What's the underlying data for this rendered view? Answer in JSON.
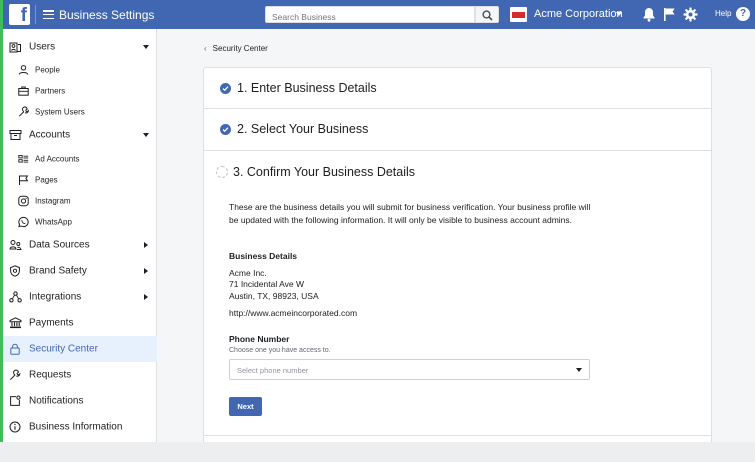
{
  "topbar": {
    "logo": "f",
    "menu_icon": "hamburger-menu-icon",
    "title": "Business Settings",
    "search_placeholder": "Search Business",
    "business_name": "Acme Corporation",
    "help_label": "Help",
    "help_glyph": "?",
    "icons": [
      "search-icon",
      "notification-bell-icon",
      "flag-icon",
      "gear-icon",
      "help-icon"
    ],
    "color": "#4267b2"
  },
  "sidebar": {
    "items": [
      {
        "label": "Users",
        "icon": "users-icon",
        "level": "top",
        "expandable": "down"
      },
      {
        "label": "People",
        "icon": "person-icon",
        "level": "sub"
      },
      {
        "label": "Partners",
        "icon": "briefcase-icon",
        "level": "sub"
      },
      {
        "label": "System Users",
        "icon": "wrench-icon",
        "level": "sub"
      },
      {
        "label": "Accounts",
        "icon": "accounts-icon",
        "level": "top",
        "expandable": "down"
      },
      {
        "label": "Ad Accounts",
        "icon": "ad-accounts-icon",
        "level": "sub"
      },
      {
        "label": "Pages",
        "icon": "flag-icon",
        "level": "sub"
      },
      {
        "label": "Instagram",
        "icon": "instagram-icon",
        "level": "sub"
      },
      {
        "label": "WhatsApp",
        "icon": "whatsapp-icon",
        "level": "sub"
      },
      {
        "label": "Data Sources",
        "icon": "data-sources-icon",
        "level": "top",
        "expandable": "right"
      },
      {
        "label": "Brand Safety",
        "icon": "shield-icon",
        "level": "top",
        "expandable": "right"
      },
      {
        "label": "Integrations",
        "icon": "integrations-icon",
        "level": "top",
        "expandable": "right"
      },
      {
        "label": "Payments",
        "icon": "bank-icon",
        "level": "top"
      },
      {
        "label": "Security Center",
        "icon": "lock-icon",
        "level": "top",
        "active": true
      },
      {
        "label": "Requests",
        "icon": "requests-icon",
        "level": "top"
      },
      {
        "label": "Notifications",
        "icon": "notifications-icon",
        "level": "top"
      },
      {
        "label": "Business Information",
        "icon": "info-icon",
        "level": "top"
      }
    ],
    "active_color": "#e7f0fd",
    "accent_color": "#3dbf58"
  },
  "main": {
    "breadcrumb": "Security Center",
    "steps": [
      {
        "title": "1. Enter Business Details",
        "status": "complete"
      },
      {
        "title": "2. Select Your Business",
        "status": "complete"
      },
      {
        "title": "3. Confirm Your Business Details",
        "status": "in-progress"
      }
    ],
    "description": "These are the business details you will submit for business verification. Your business profile will be updated with the following information. It will only be visible to business account admins.",
    "business_details_title": "Business Details",
    "business_name": "Acme Inc.",
    "address_line1": "71 Incidental Ave W",
    "address_line2": "Austin, TX, 98923, USA",
    "website": "http://www.acmeincorporated.com",
    "phone_title": "Phone Number",
    "phone_hint": "Choose one you have access to.",
    "phone_placeholder": "Select phone number",
    "next_label": "Next"
  }
}
